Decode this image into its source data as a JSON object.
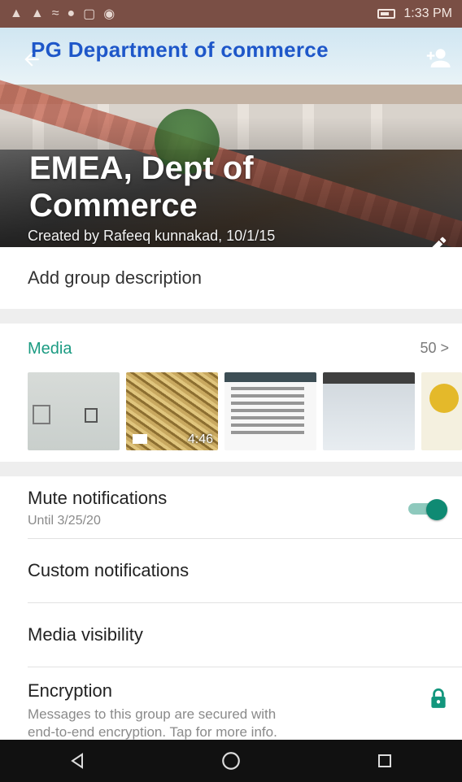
{
  "status_bar": {
    "time": "1:33 PM"
  },
  "header": {
    "banner_text": "PG Department of commerce",
    "group_name": "EMEA, Dept of Commerce",
    "created_by": "Created by Rafeeq kunnakad, 10/1/15"
  },
  "description": {
    "placeholder": "Add group description"
  },
  "media": {
    "title": "Media",
    "count": "50 >",
    "thumbnails": [
      {
        "name": "wall-photo"
      },
      {
        "name": "rice-video",
        "duration": "4:46"
      },
      {
        "name": "document-screenshot"
      },
      {
        "name": "screen-photo"
      },
      {
        "name": "yellow-poster"
      }
    ]
  },
  "settings": {
    "mute": {
      "title": "Mute notifications",
      "subtitle": "Until 3/25/20",
      "enabled": true
    },
    "custom": {
      "title": "Custom notifications"
    },
    "visibility": {
      "title": "Media visibility"
    },
    "encryption": {
      "title": "Encryption",
      "subtitle_line1": "Messages to this group are secured with",
      "subtitle_line2": "end-to-end encryption. Tap for more info."
    }
  },
  "colors": {
    "accent": "#0f8a73",
    "status_bar": "#7a4f45",
    "banner_text": "#1e57c9"
  },
  "icons": {
    "back": "arrow-back-icon",
    "add_member": "add-person-icon",
    "edit": "pencil-icon",
    "lock": "lock-icon",
    "nav_back": "triangle-back-icon",
    "nav_home": "circle-home-icon",
    "nav_recent": "square-recent-icon"
  }
}
